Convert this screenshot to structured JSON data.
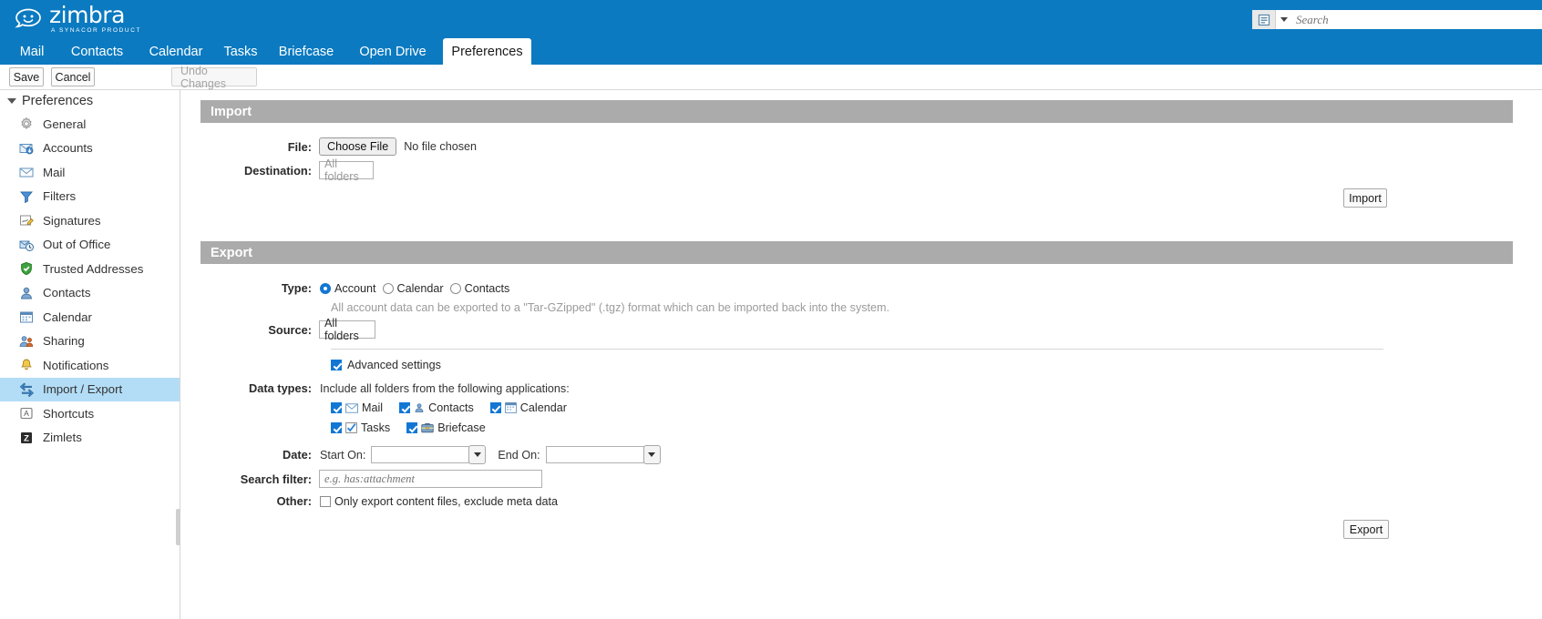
{
  "app": {
    "name": "zimbra",
    "tagline": "A SYNACOR PRODUCT"
  },
  "search": {
    "placeholder": "Search",
    "value": "",
    "type_icon": "mail-list-icon"
  },
  "tabs": [
    {
      "label": "Mail",
      "active": false
    },
    {
      "label": "Contacts",
      "active": false
    },
    {
      "label": "Calendar",
      "active": false
    },
    {
      "label": "Tasks",
      "active": false
    },
    {
      "label": "Briefcase",
      "active": false
    },
    {
      "label": "Open Drive",
      "active": false
    },
    {
      "label": "Preferences",
      "active": true
    }
  ],
  "toolbar": {
    "save_label": "Save",
    "cancel_label": "Cancel",
    "undo_label": "Undo Changes"
  },
  "sidebar": {
    "header": "Preferences",
    "items": [
      {
        "label": "General",
        "icon": "gear-icon",
        "selected": false
      },
      {
        "label": "Accounts",
        "icon": "accounts-icon",
        "selected": false
      },
      {
        "label": "Mail",
        "icon": "envelope-icon",
        "selected": false
      },
      {
        "label": "Filters",
        "icon": "filters-icon",
        "selected": false
      },
      {
        "label": "Signatures",
        "icon": "signature-icon",
        "selected": false
      },
      {
        "label": "Out of Office",
        "icon": "out-of-office-icon",
        "selected": false
      },
      {
        "label": "Trusted Addresses",
        "icon": "shield-check-icon",
        "selected": false
      },
      {
        "label": "Contacts",
        "icon": "contact-icon",
        "selected": false
      },
      {
        "label": "Calendar",
        "icon": "calendar-icon",
        "selected": false
      },
      {
        "label": "Sharing",
        "icon": "sharing-icon",
        "selected": false
      },
      {
        "label": "Notifications",
        "icon": "bell-icon",
        "selected": false
      },
      {
        "label": "Import / Export",
        "icon": "import-export-icon",
        "selected": true
      },
      {
        "label": "Shortcuts",
        "icon": "shortcuts-icon",
        "selected": false
      },
      {
        "label": "Zimlets",
        "icon": "zimlets-icon",
        "selected": false
      }
    ]
  },
  "import": {
    "title": "Import",
    "file_label": "File:",
    "choose_file_button": "Choose File",
    "file_status": "No file chosen",
    "destination_label": "Destination:",
    "destination_value": "All folders",
    "import_button": "Import"
  },
  "export": {
    "title": "Export",
    "type_label": "Type:",
    "type_options": [
      {
        "label": "Account",
        "checked": true
      },
      {
        "label": "Calendar",
        "checked": false
      },
      {
        "label": "Contacts",
        "checked": false
      }
    ],
    "type_hint": "All account data can be exported to a \"Tar-GZipped\" (.tgz) format which can be imported back into the system.",
    "source_label": "Source:",
    "source_value": "All folders",
    "advanced_settings_label": "Advanced settings",
    "advanced_settings_checked": true,
    "data_types_label": "Data types:",
    "data_types_hint": "Include all folders from the following applications:",
    "data_types_row1": [
      {
        "label": "Mail",
        "icon": "envelope-icon",
        "checked": true
      },
      {
        "label": "Contacts",
        "icon": "contact-icon",
        "checked": true
      },
      {
        "label": "Calendar",
        "icon": "calendar-icon",
        "checked": true
      }
    ],
    "data_types_row2": [
      {
        "label": "Tasks",
        "icon": "task-check-icon",
        "checked": true
      },
      {
        "label": "Briefcase",
        "icon": "briefcase-icon",
        "checked": true
      }
    ],
    "date_label": "Date:",
    "start_on_label": "Start On:",
    "start_on_value": "",
    "end_on_label": "End On:",
    "end_on_value": "",
    "search_filter_label": "Search filter:",
    "search_filter_placeholder": "e.g. has:attachment",
    "search_filter_value": "",
    "other_label": "Other:",
    "other_option_label": "Only export content files, exclude meta data",
    "other_option_checked": false,
    "export_button": "Export"
  },
  "colors": {
    "brand_blue": "#0b7ac0",
    "band_gray": "#ababab",
    "selection_blue": "#b3ddf6",
    "accent": "#1277d4"
  }
}
